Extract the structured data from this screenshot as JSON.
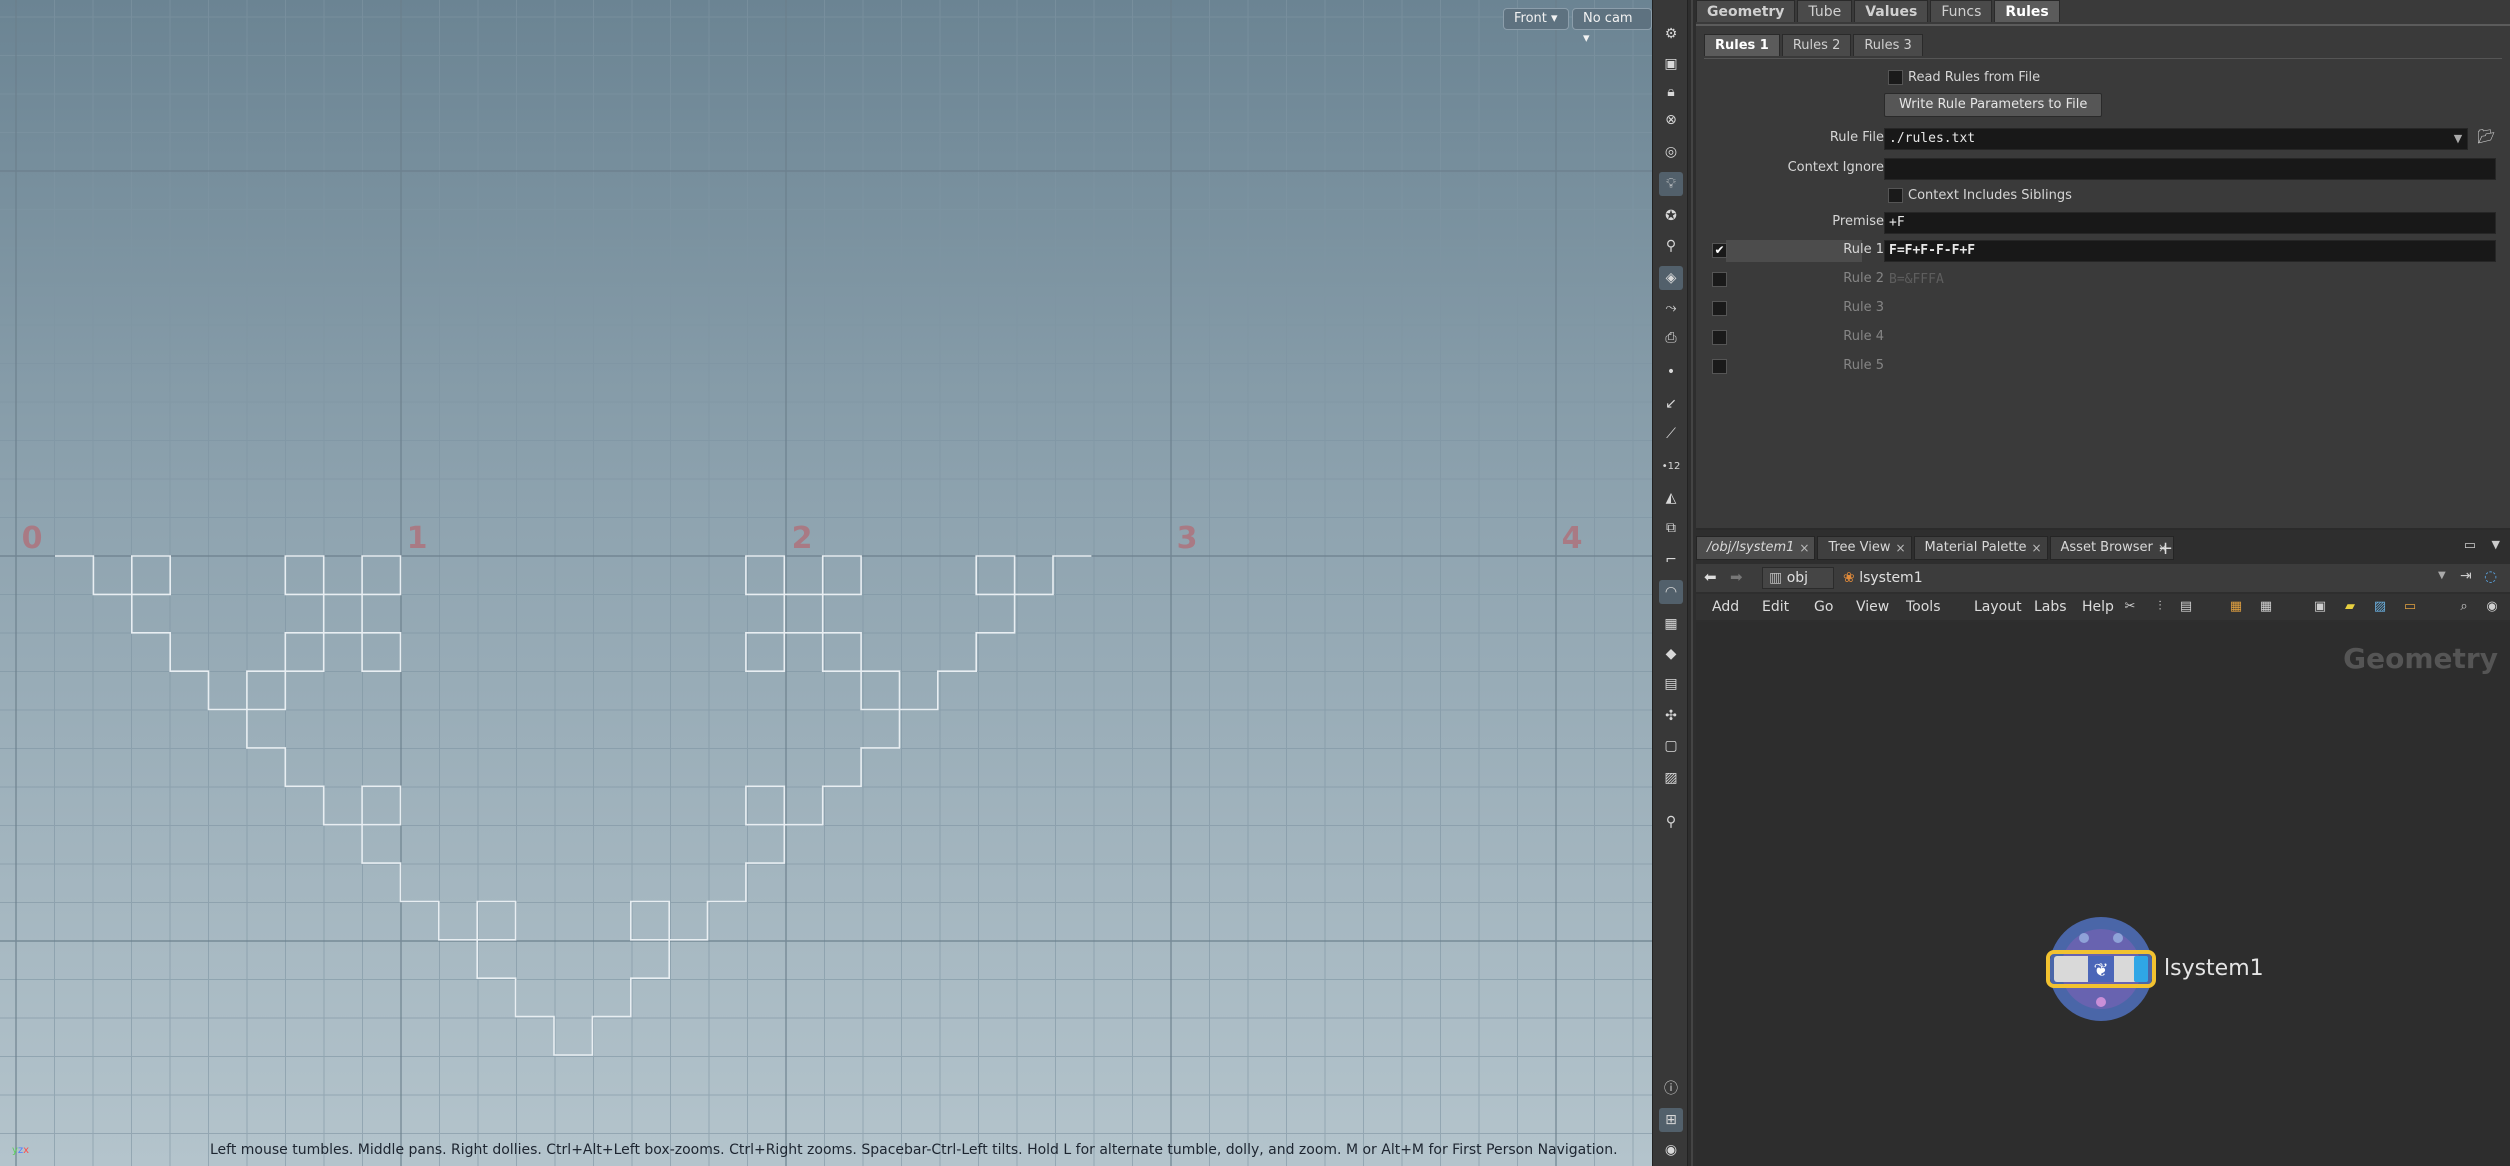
{
  "viewport": {
    "camera_view": "Front",
    "camera": "No cam",
    "ruler_numbers": [
      "0",
      "1",
      "2",
      "3",
      "4"
    ],
    "hint": "Left mouse tumbles. Middle pans. Right dollies. Ctrl+Alt+Left box-zooms. Ctrl+Right zooms. Spacebar-Ctrl-Left tilts. Hold L for alternate tumble, dolly, and zoom.     M or Alt+M for First Person Navigation.",
    "axis_labels": {
      "y": "y",
      "z": "z",
      "x": "x"
    },
    "colors": {
      "sky_top": "#6b8493",
      "sky_bottom": "#b4c4cc",
      "curve": "#e8eef2",
      "ruler": "#a97a84"
    }
  },
  "params": {
    "tabs": [
      "Geometry",
      "Tube",
      "Values",
      "Funcs",
      "Rules"
    ],
    "selected_tab": "Rules",
    "subtabs": [
      "Rules 1",
      "Rules 2",
      "Rules 3"
    ],
    "selected_subtab": "Rules 1",
    "read_rules_label": "Read Rules from File",
    "write_button": "Write Rule Parameters to File",
    "rule_file_label": "Rule File",
    "rule_file_value": "./rules.txt",
    "context_ignore_label": "Context Ignore",
    "context_ignore_value": "",
    "context_siblings_label": "Context Includes Siblings",
    "premise_label": "Premise",
    "premise_value": "+F",
    "rules": [
      {
        "label": "Rule 1",
        "value": "F=F+F-F-F+F",
        "enabled": true
      },
      {
        "label": "Rule 2",
        "value": "B=&FFFA",
        "enabled": false
      },
      {
        "label": "Rule 3",
        "value": "",
        "enabled": false
      },
      {
        "label": "Rule 4",
        "value": "",
        "enabled": false
      },
      {
        "label": "Rule 5",
        "value": "",
        "enabled": false
      }
    ]
  },
  "network": {
    "tabs": [
      "/obj/lsystem1",
      "Tree View",
      "Material Palette",
      "Asset Browser"
    ],
    "path": {
      "root": "obj",
      "node": "lsystem1"
    },
    "menu": [
      "Add",
      "Edit",
      "Go",
      "View",
      "Tools",
      "Layout",
      "Labs",
      "Help"
    ],
    "context_label": "Geometry",
    "node_name": "lsystem1",
    "node_colors": {
      "ring": "#4a66a8",
      "body": "#6c63b0",
      "flag": "#f2c230",
      "highlight": "#2fa6e6"
    }
  }
}
